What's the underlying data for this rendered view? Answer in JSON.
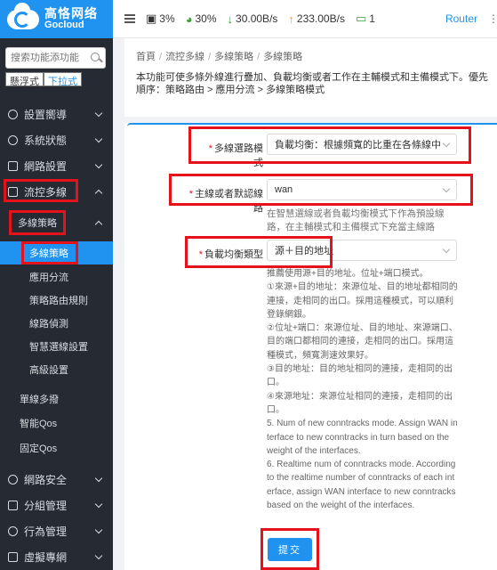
{
  "brand": {
    "name_cn": "高恪网络",
    "name_en": "Gocloud"
  },
  "topbar": {
    "cpu": "3%",
    "mem": "30%",
    "down": "30.00B/s",
    "up": "233.00B/s",
    "clients": "1",
    "router_label": "Router",
    "more": "⋮"
  },
  "sidebar": {
    "search_placeholder": "搜索功能添功能",
    "mode_tabs": [
      "懸浮式",
      "下拉式"
    ],
    "items": [
      {
        "label": "設置嚮導",
        "icon": "settings-icon"
      },
      {
        "label": "系統狀態",
        "icon": "gauge-icon"
      },
      {
        "label": "網路設置",
        "icon": "monitor-icon"
      },
      {
        "label": "流控多線",
        "icon": "flow-icon"
      },
      {
        "label": "多線策略"
      },
      {
        "label": "單線多撥"
      },
      {
        "label": "智能Qos"
      },
      {
        "label": "固定Qos"
      },
      {
        "label": "網路安全",
        "icon": "shield-icon"
      },
      {
        "label": "分組管理",
        "icon": "group-icon"
      },
      {
        "label": "行為管理",
        "icon": "behavior-icon"
      },
      {
        "label": "虛擬專網",
        "icon": "vpn-icon"
      }
    ],
    "sub_items": [
      "多線策略",
      "應用分流",
      "策略路由規則",
      "線路偵測",
      "智慧選線設置",
      "高級設置"
    ]
  },
  "breadcrumb": [
    "首頁",
    "流控多線",
    "多線策略",
    "多線策略"
  ],
  "description": "本功能可使多條外線進行疊加、負載均衡或者工作在主輔模式和主備模式下。優先順序：策略路由 > 應用分流 > 多線策略模式",
  "form": {
    "mode_label": "多線選路模式",
    "mode_value": "負載均衡：根據頻寬的比重在各條線中...",
    "default_line_label": "主線或者默認線路",
    "default_line_value": "wan",
    "default_line_hint": "在智慧選線或者負載均衡模式下作為預設線路，在主輔模式和主備模式下充當主線路",
    "balance_type_label": "負載均衡類型",
    "balance_type_value": "源＋目的地址",
    "notes": [
      "推薦使用源+目的地址。位址+端口模式。",
      "①來源+目的地址：來源位址、目的地址都相同的連接，走相同的出口。採用這種模式，可以順利登錄網銀。",
      "②位址+端口：來源位址、目的地址、來源端口、目的端口都相同的連接，走相同的出口。採用這種模式，頻寬測速效果好。",
      "③目的地址：目的地址相同的連接，走相同的出口。",
      "④來源地址：來源位址相同的連接，走相同的出口。",
      "5. Num of new conntracks mode. Assign WAN interface to new conntracks in turn based on the weight of the interfaces.",
      "6. Realtime num of conntracks mode. According to the realtime number of conntracks of each interface, assign WAN interface to new conntracks based on the weight of the interfaces."
    ],
    "submit_label": "提交"
  },
  "colors": {
    "accent": "#1f93ef",
    "highlight": "#e5111b",
    "sidebar_bg": "#262b33"
  }
}
